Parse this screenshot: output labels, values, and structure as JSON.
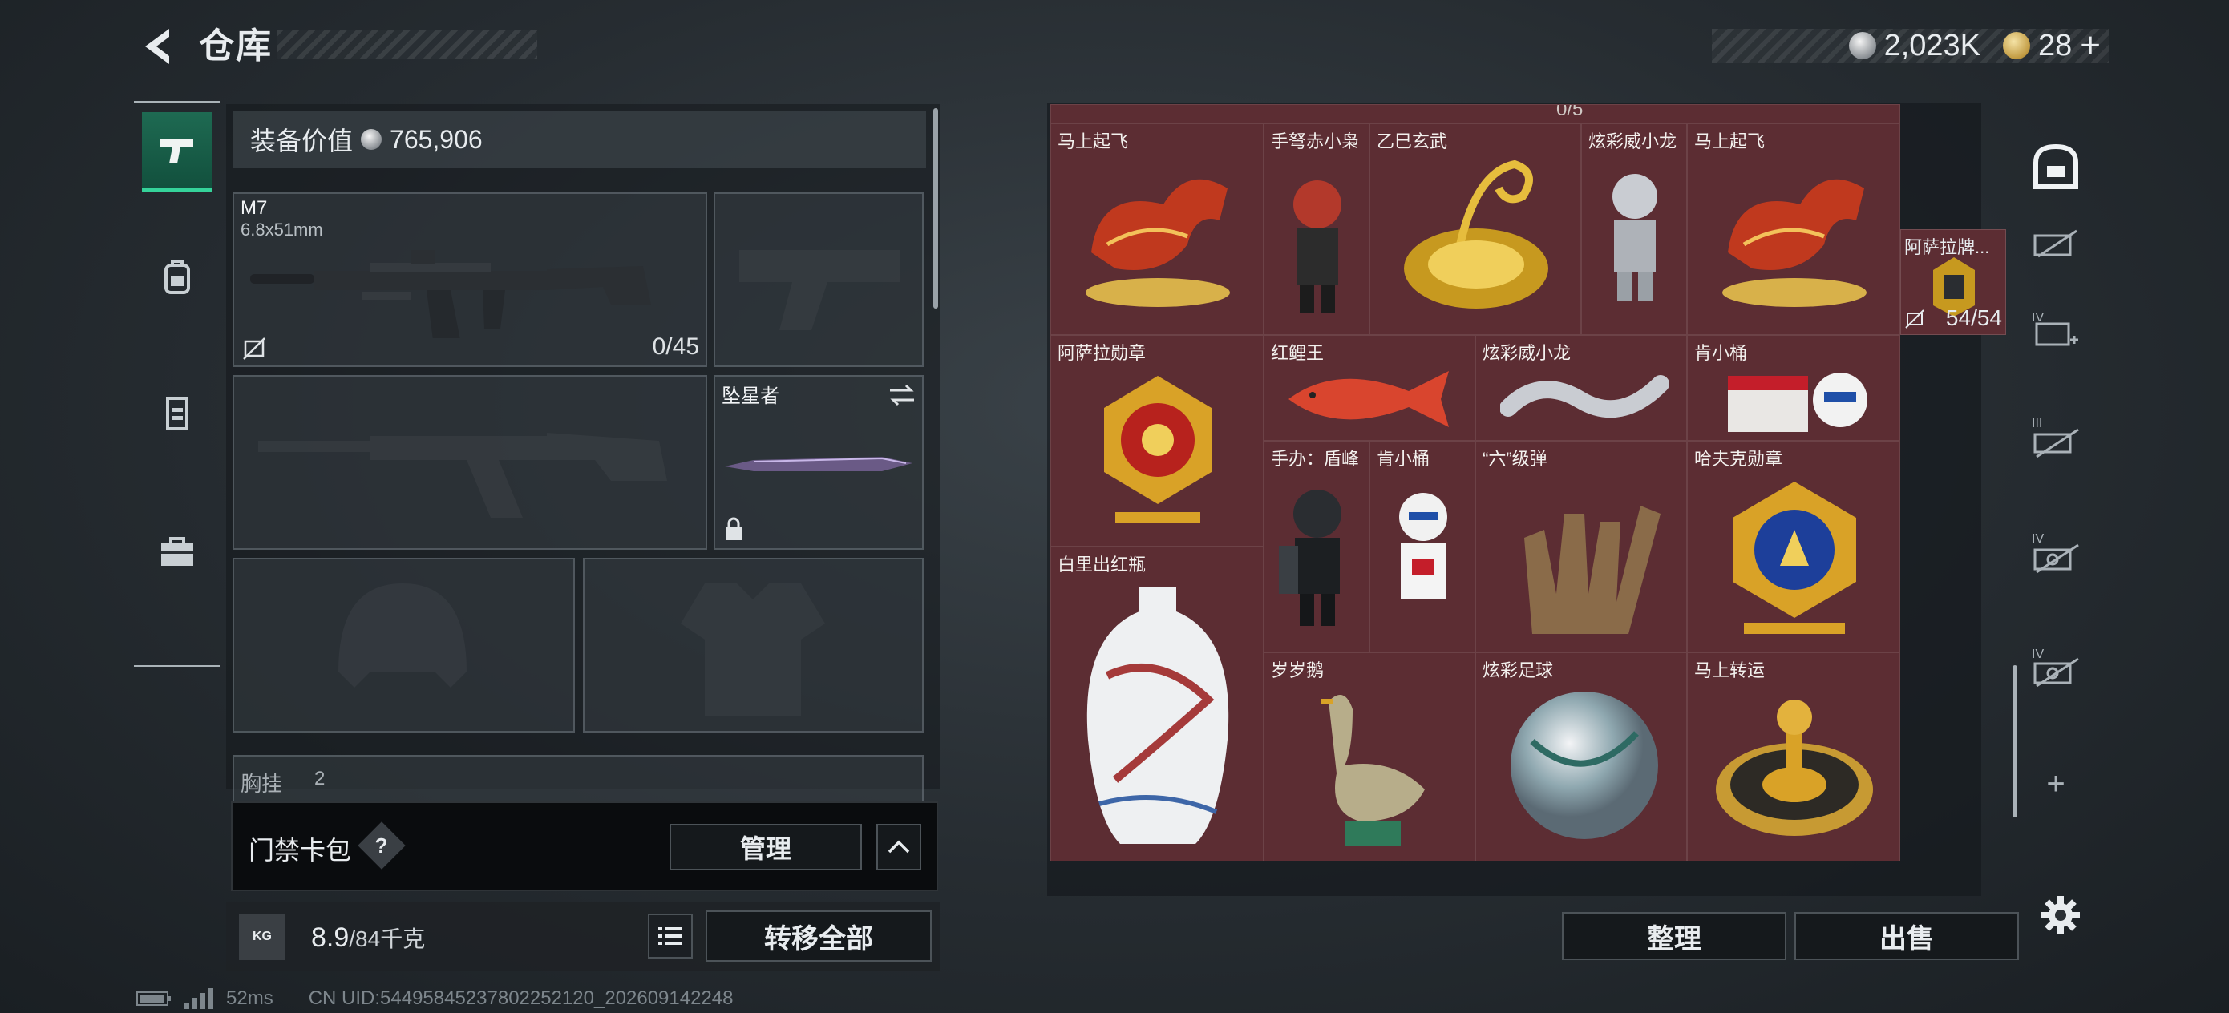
{
  "header": {
    "title": "仓库",
    "silver_amount": "2,023K",
    "gold_amount": "28",
    "gold_plus": "+",
    "top_small_text": ""
  },
  "equipment": {
    "value_label": "装备价值",
    "value": "765,906",
    "primary": {
      "name": "M7",
      "caliber": "6.8x51mm",
      "ammo": "0/45"
    },
    "melee": {
      "name": "坠星者"
    },
    "chest_rig_label": "胸挂",
    "chest_rig_count": "2"
  },
  "keycard": {
    "label": "门禁卡包",
    "help": "?",
    "manage_label": "管理"
  },
  "weight": {
    "current": "8.9",
    "capacity": "/84千克",
    "icon_text": "KG"
  },
  "transfer_label": "转移全部",
  "status": {
    "ping": "52ms",
    "uid": "CN UID:5449584523780​2252120_202609142248"
  },
  "inventory": {
    "top_count": "0/5",
    "items": [
      {
        "label": "马上起飞",
        "kind": "horse"
      },
      {
        "label": "手弩赤小枭",
        "kind": "figure-red"
      },
      {
        "label": "乙巳玄武",
        "kind": "gold-serpent"
      },
      {
        "label": "炫彩威小龙",
        "kind": "figure-silver"
      },
      {
        "label": "马上起飞",
        "kind": "horse"
      },
      {
        "label": "阿萨拉勋章",
        "kind": "medal-red"
      },
      {
        "label": "红鲤王",
        "kind": "fish"
      },
      {
        "label": "炫彩威小龙",
        "kind": "silver-dragon"
      },
      {
        "label": "肯小桶",
        "kind": "bucket"
      },
      {
        "label": "手办：盾峰",
        "kind": "figure-black"
      },
      {
        "label": "肯小桶",
        "kind": "figure-white"
      },
      {
        "label": "“六”级弹",
        "kind": "bronze-hand"
      },
      {
        "label": "哈夫克勋章",
        "kind": "medal-blue"
      },
      {
        "label": "白里出红瓶",
        "kind": "vase"
      },
      {
        "label": "岁岁鹅",
        "kind": "goose"
      },
      {
        "label": "炫彩足球",
        "kind": "ball"
      },
      {
        "label": "马上转运",
        "kind": "wheel"
      }
    ],
    "side_item": {
      "label": "阿萨拉牌...",
      "count": "54/54"
    },
    "sort_label": "整理",
    "sell_label": "出售"
  },
  "rail": {
    "tiers": [
      "IV",
      "III",
      "IV",
      "IV"
    ],
    "add": "+"
  }
}
